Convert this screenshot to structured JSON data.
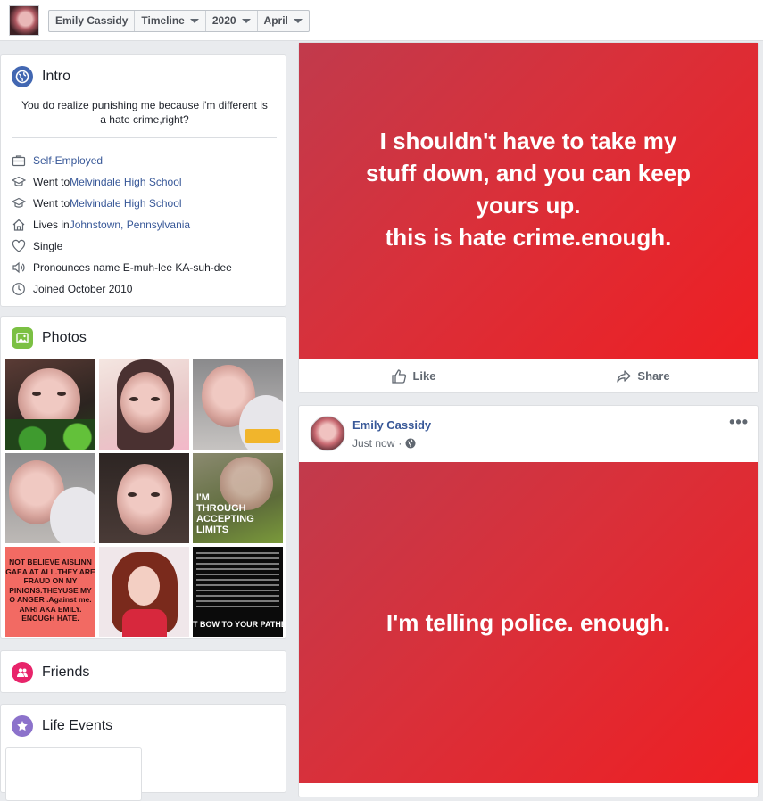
{
  "topbar": {
    "crumbs": [
      {
        "label": "Emily Cassidy",
        "dropdown": false
      },
      {
        "label": "Timeline",
        "dropdown": true
      },
      {
        "label": "2020",
        "dropdown": true
      },
      {
        "label": "April",
        "dropdown": true
      }
    ]
  },
  "intro": {
    "title": "Intro",
    "bio": "You do realize punishing me because i'm different is a hate crime,right?",
    "items": [
      {
        "icon": "briefcase-icon",
        "prefix": "",
        "link": "Self-Employed"
      },
      {
        "icon": "graduation-cap-icon",
        "prefix": "Went to ",
        "link": "Melvindale High School"
      },
      {
        "icon": "graduation-cap-icon",
        "prefix": "Went to ",
        "link": "Melvindale High School"
      },
      {
        "icon": "home-icon",
        "prefix": "Lives in ",
        "link": "Johnstown, Pennsylvania"
      },
      {
        "icon": "heart-icon",
        "prefix": "Single",
        "link": ""
      },
      {
        "icon": "speaker-icon",
        "prefix": "Pronounces name E-muh-lee KA-suh-dee",
        "link": ""
      },
      {
        "icon": "clock-icon",
        "prefix": "Joined October 2010",
        "link": ""
      }
    ]
  },
  "photos": {
    "title": "Photos",
    "tiles": [
      {
        "kind": "selfie-green"
      },
      {
        "kind": "selfie-pink"
      },
      {
        "kind": "selfie-side"
      },
      {
        "kind": "selfie-close"
      },
      {
        "kind": "selfie-plain"
      },
      {
        "kind": "text-witch",
        "text": "I'M THROUGH ACCEPTING LIMITS"
      },
      {
        "kind": "text-red",
        "text": "NOT BELIEVE AISLINN GAEA AT ALL.THEY ARE FRAUD ON MY PINIONS.THEYUSE MY O ANGER .Against me. ANRI AKA EMILY. ENOUGH HATE."
      },
      {
        "kind": "drawing"
      },
      {
        "kind": "text-black",
        "text": "T BOW TO YOUR PATHET"
      }
    ]
  },
  "friends": {
    "title": "Friends"
  },
  "life_events": {
    "title": "Life Events"
  },
  "post1": {
    "text": "I shouldn't have to take my\nstuff down, and you can keep\nyours up.\nthis is hate crime.enough.",
    "like_label": "Like",
    "share_label": "Share"
  },
  "post2": {
    "author": "Emily Cassidy",
    "time": "Just now",
    "separator": "·",
    "more": "•••",
    "text": "I'm telling police. enough."
  },
  "colors": {
    "link": "#385898",
    "post_bg_start": "#c13a4c",
    "post_bg_end": "#ee1f23",
    "intro_icon": "#4267b2",
    "photos_icon": "#7bc043",
    "friends_icon": "#e8246a",
    "life_icon": "#8c72cb"
  }
}
